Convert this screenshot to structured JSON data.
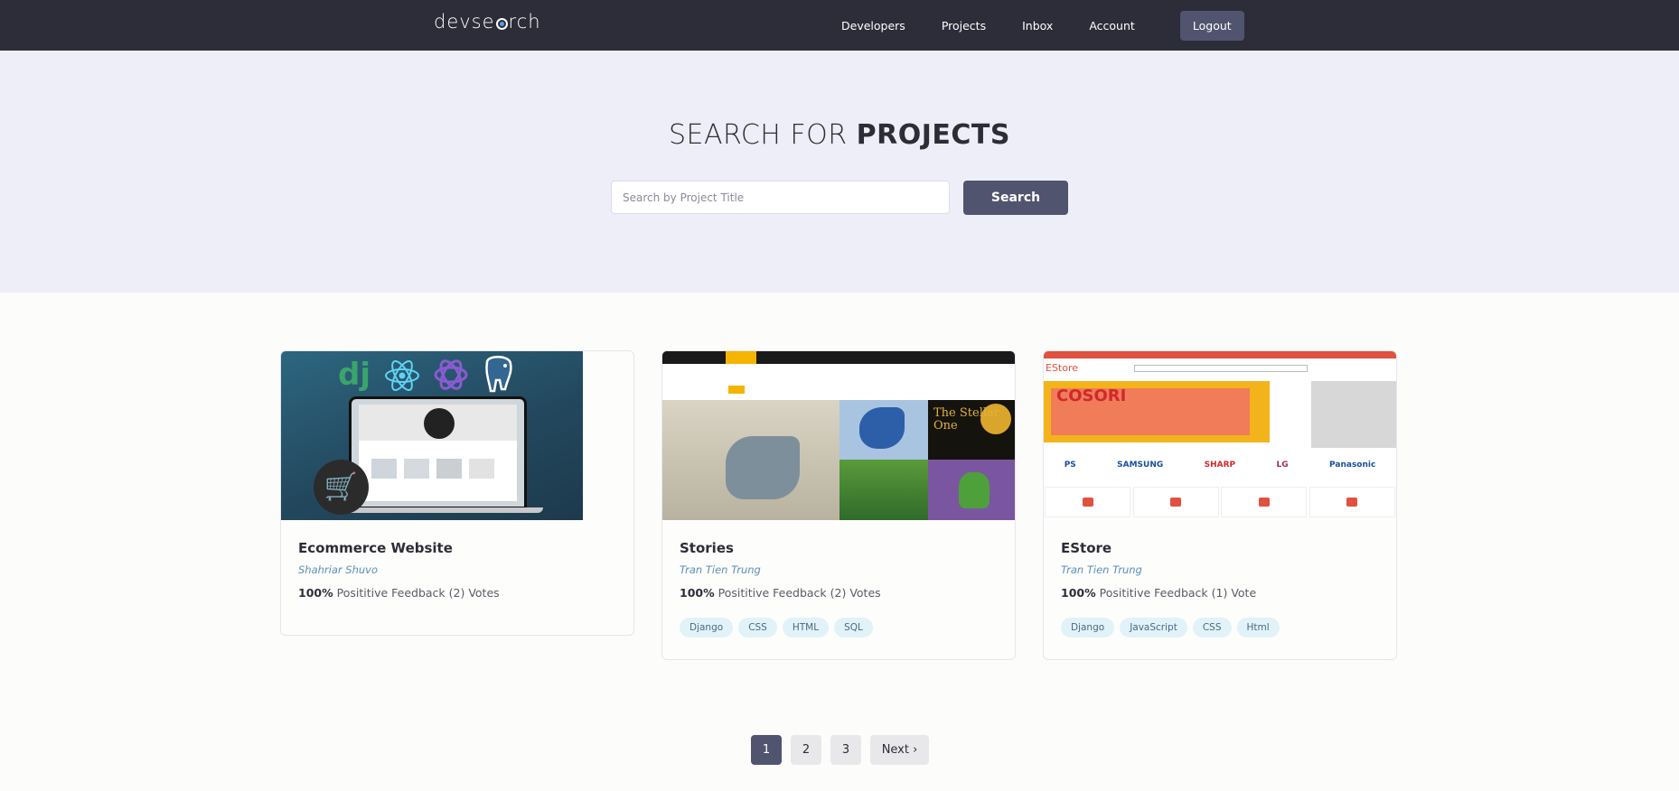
{
  "navbar": {
    "logo_left": "devse",
    "logo_right": "rch",
    "links": [
      "Developers",
      "Projects",
      "Inbox",
      "Account"
    ],
    "logout": "Logout"
  },
  "hero": {
    "title_prefix": "SEARCH FOR",
    "title_bold": "PROJECTS",
    "search_placeholder": "Search by Project Title",
    "search_button": "Search"
  },
  "projects": [
    {
      "title": "Ecommerce Website",
      "author": "Shahriar Shuvo",
      "feedback_percent": "100%",
      "feedback_text": "Posititive Feedback (2) Votes",
      "tags": []
    },
    {
      "title": "Stories",
      "author": "Tran Tien Trung",
      "feedback_percent": "100%",
      "feedback_text": "Posititive Feedback (2) Votes",
      "tags": [
        "Django",
        "CSS",
        "HTML",
        "SQL"
      ]
    },
    {
      "title": "EStore",
      "author": "Tran Tien Trung",
      "feedback_percent": "100%",
      "feedback_text": "Posititive Feedback (1) Vote",
      "tags": [
        "Django",
        "JavaScript",
        "CSS",
        "Html"
      ]
    }
  ],
  "estore_thumb": {
    "logo": "EStore",
    "banner": "COSORI",
    "brands": [
      "PS",
      "SAMSUNG",
      "SHARP",
      "LG",
      "Panasonic"
    ]
  },
  "stories_thumb": {
    "panel_text": "The Stellar One"
  },
  "ecommerce_thumb": {
    "badge": "dj"
  },
  "pagination": {
    "pages": [
      "1",
      "2",
      "3"
    ],
    "active": "1",
    "next": "Next ›"
  },
  "colors": {
    "navbar": "#2d2d39",
    "hero_bg": "#eeeef9",
    "accent": "#51546e",
    "tag_bg": "#e1f2f9",
    "author": "#5b8fb8"
  }
}
